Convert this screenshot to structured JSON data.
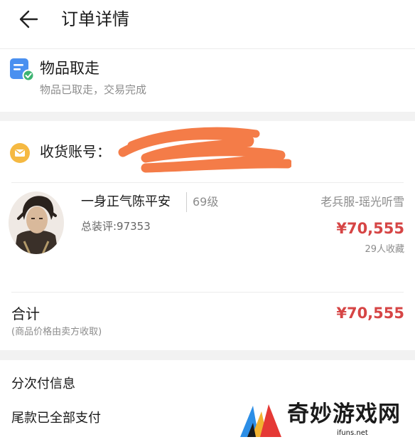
{
  "header": {
    "title": "订单详情",
    "back_icon": "arrow-left-icon"
  },
  "status": {
    "icon": "receipt-check-icon",
    "title": "物品取走",
    "subtitle": "物品已取走，交易完成",
    "icon_color": "#4a90f0",
    "check_color": "#3cb371"
  },
  "account": {
    "icon": "mail-icon",
    "label": "收货账号：",
    "icon_color": "#f5b942",
    "scribble_color": "#f47c48"
  },
  "item": {
    "avatar": "character-avatar",
    "name": "一身正气陈平安",
    "level": "69级",
    "score": "总装评:97353",
    "server": "老兵服-瑶光听雪",
    "price": "¥70,555",
    "favorites": "29人收藏"
  },
  "total": {
    "label": "合计",
    "note": "(商品价格由卖方收取)",
    "price": "¥70,555"
  },
  "payment": {
    "title": "分次付信息",
    "status": "尾款已全部支付"
  },
  "watermark": {
    "name": "奇妙游戏网",
    "url": "ifuns.net"
  },
  "colors": {
    "price_red": "#d64545",
    "background": "#f2f2f2"
  }
}
